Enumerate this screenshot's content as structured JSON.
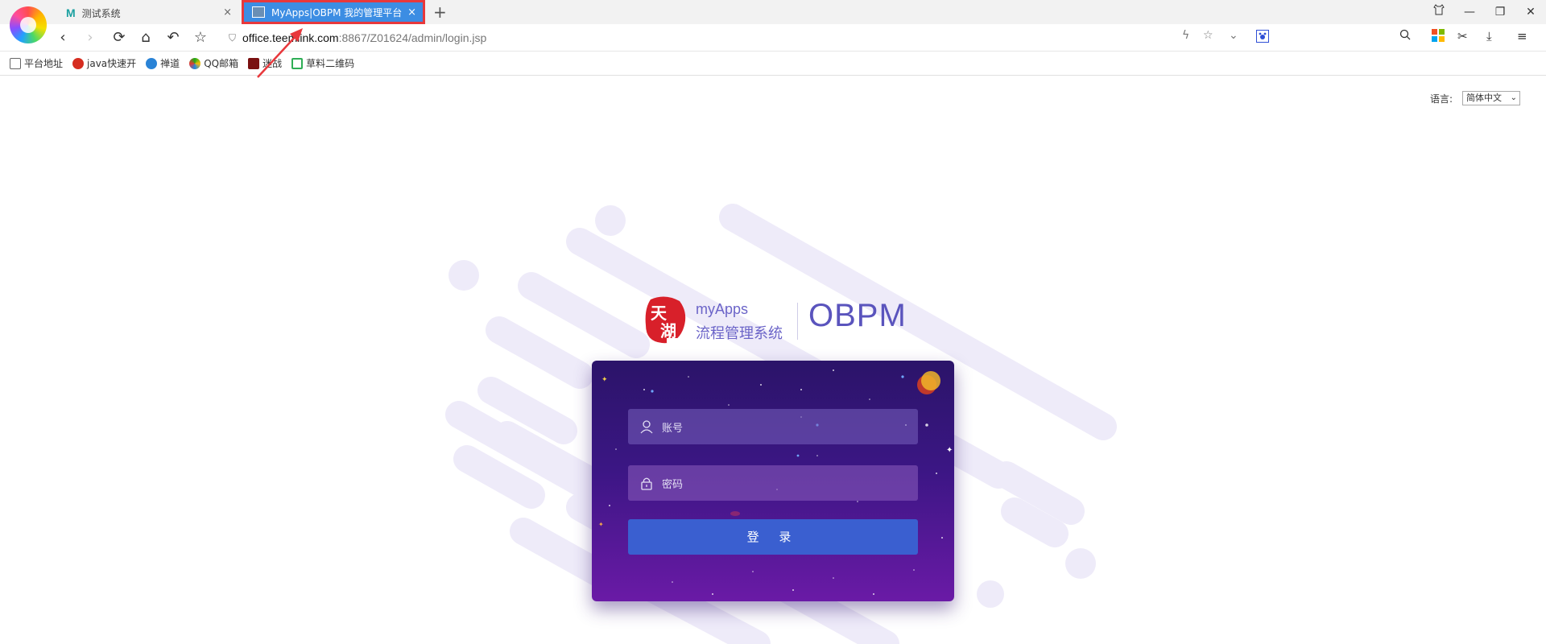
{
  "browser": {
    "tabs": [
      {
        "title": "测试系统",
        "favicon": "M"
      },
      {
        "title": "MyApps|OBPM 我的管理平台",
        "active": true
      }
    ],
    "new_tab_symbol": "+",
    "address": {
      "domain": "office.teemlink.com",
      "path": ":8867/Z01624/admin/login.jsp"
    },
    "bookmarks": [
      {
        "label": "平台地址",
        "icon": "folder-icon"
      },
      {
        "label": "java快速开",
        "icon": "java-icon"
      },
      {
        "label": "禅道",
        "icon": "zentao-icon"
      },
      {
        "label": "QQ邮箱",
        "icon": "qq-mail-icon"
      },
      {
        "label": "迷战",
        "icon": "game-icon"
      },
      {
        "label": "草料二维码",
        "icon": "qrcode-icon"
      }
    ]
  },
  "page": {
    "language_label": "语言:",
    "language_value": "简体中文",
    "logo": {
      "brand": "myApps",
      "subtitle": "流程管理系统",
      "product": "OBPM"
    },
    "login": {
      "account_placeholder": "账号",
      "password_placeholder": "密码",
      "submit_label": "登 录"
    }
  },
  "colors": {
    "accent": "#3a5fd0",
    "card_top": "#2b1469",
    "card_bottom": "#6a1aa6",
    "brand_text": "#5a54bd",
    "tab_active": "#3c8de3",
    "highlight": "#e8383c"
  }
}
